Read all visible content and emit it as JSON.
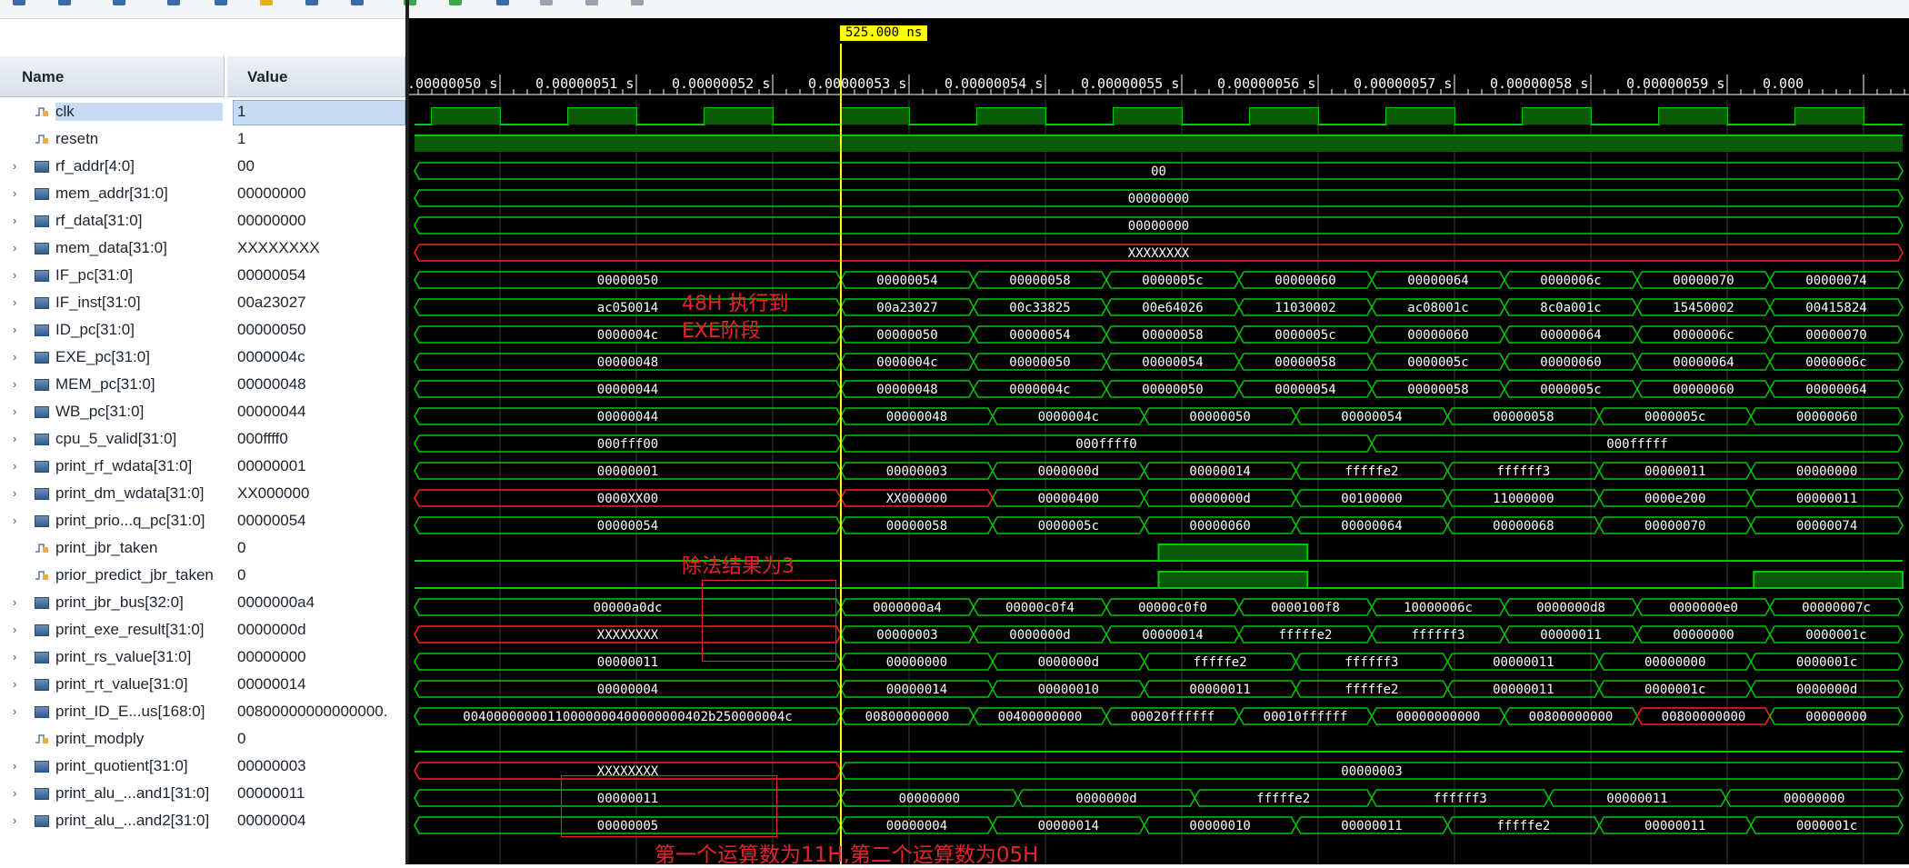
{
  "toolbar": {
    "buttons": [
      {
        "icon": "undo-icon",
        "color": "#3a6aa8"
      },
      {
        "icon": "save-icon",
        "color": "#3a6aa8"
      },
      {
        "icon": "zoom-in-icon",
        "color": "#3a6aa8"
      },
      {
        "icon": "zoom-out-icon",
        "color": "#3a6aa8"
      },
      {
        "icon": "zoom-fit-icon",
        "color": "#3a6aa8"
      },
      {
        "icon": "marker-icon",
        "color": "#e0b020"
      },
      {
        "icon": "go-to-start-icon",
        "color": "#3a6aa8"
      },
      {
        "icon": "go-to-end-icon",
        "color": "#3a6aa8"
      },
      {
        "icon": "previous-transition-icon",
        "color": "#3aa84a"
      },
      {
        "icon": "next-transition-icon",
        "color": "#3aa84a"
      },
      {
        "icon": "add-marker-icon",
        "color": "#3a6aa8"
      },
      {
        "icon": "previous-marker-icon",
        "color": "#9aa3ad"
      },
      {
        "icon": "next-marker-icon",
        "color": "#9aa3ad"
      },
      {
        "icon": "swap-cursors-icon",
        "color": "#9aa3ad"
      }
    ]
  },
  "columns": {
    "name": "Name",
    "value": "Value"
  },
  "cursor_time": "525.000 ns",
  "colors": {
    "bus": "#00c800",
    "bit": "#00c800",
    "invalid": "#ff2020",
    "cursor": "#ffff00",
    "annotation": "#e8232b",
    "waveform_background": "#000000"
  },
  "time_ticks": [
    "0.00000050 s",
    "0.00000051 s",
    "0.00000052 s",
    "0.00000053 s",
    "0.00000054 s",
    "0.00000055 s",
    "0.00000056 s",
    "0.00000057 s",
    "0.00000058 s",
    "0.00000059 s",
    "0.000"
  ],
  "signals": [
    {
      "name": "clk",
      "value": "1",
      "type": "clock"
    },
    {
      "name": "resetn",
      "value": "1",
      "type": "high"
    },
    {
      "name": "rf_addr[4:0]",
      "value": "00",
      "type": "bus",
      "segments": [
        {
          "text": "00"
        }
      ]
    },
    {
      "name": "mem_addr[31:0]",
      "value": "00000000",
      "type": "bus",
      "segments": [
        {
          "text": "00000000"
        }
      ]
    },
    {
      "name": "rf_data[31:0]",
      "value": "00000000",
      "type": "bus",
      "segments": [
        {
          "text": "00000000"
        }
      ]
    },
    {
      "name": "mem_data[31:0]",
      "value": "XXXXXXXX",
      "type": "bus",
      "segments": [
        {
          "text": "XXXXXXXX",
          "x": true
        }
      ]
    },
    {
      "name": "IF_pc[31:0]",
      "value": "00000054",
      "type": "bus",
      "segments": [
        {
          "text": "00000050"
        },
        {
          "text": "00000054"
        },
        {
          "text": "00000058"
        },
        {
          "text": "0000005c"
        },
        {
          "text": "00000060"
        },
        {
          "text": "00000064"
        },
        {
          "text": "0000006c"
        },
        {
          "text": "00000070"
        },
        {
          "text": "00000074"
        }
      ]
    },
    {
      "name": "IF_inst[31:0]",
      "value": "00a23027",
      "type": "bus",
      "segments": [
        {
          "text": "ac050014"
        },
        {
          "text": "00a23027"
        },
        {
          "text": "00c33825"
        },
        {
          "text": "00e64026"
        },
        {
          "text": "11030002"
        },
        {
          "text": "ac08001c"
        },
        {
          "text": "8c0a001c"
        },
        {
          "text": "15450002"
        },
        {
          "text": "00415824"
        }
      ]
    },
    {
      "name": "ID_pc[31:0]",
      "value": "00000050",
      "type": "bus",
      "segments": [
        {
          "text": "0000004c"
        },
        {
          "text": "00000050"
        },
        {
          "text": "00000054"
        },
        {
          "text": "00000058"
        },
        {
          "text": "0000005c"
        },
        {
          "text": "00000060"
        },
        {
          "text": "00000064"
        },
        {
          "text": "0000006c"
        },
        {
          "text": "00000070"
        }
      ]
    },
    {
      "name": "EXE_pc[31:0]",
      "value": "0000004c",
      "type": "bus",
      "segments": [
        {
          "text": "00000048"
        },
        {
          "text": "0000004c"
        },
        {
          "text": "00000050"
        },
        {
          "text": "00000054"
        },
        {
          "text": "00000058"
        },
        {
          "text": "0000005c"
        },
        {
          "text": "00000060"
        },
        {
          "text": "00000064"
        },
        {
          "text": "0000006c"
        }
      ]
    },
    {
      "name": "MEM_pc[31:0]",
      "value": "00000048",
      "type": "bus",
      "segments": [
        {
          "text": "00000044"
        },
        {
          "text": "00000048"
        },
        {
          "text": "0000004c"
        },
        {
          "text": "00000050"
        },
        {
          "text": "00000054"
        },
        {
          "text": "00000058"
        },
        {
          "text": "0000005c"
        },
        {
          "text": "00000060"
        },
        {
          "text": "00000064"
        }
      ]
    },
    {
      "name": "WB_pc[31:0]",
      "value": "00000044",
      "type": "bus",
      "segments": [
        {
          "text": "00000044"
        },
        {
          "text": "00000048"
        },
        {
          "text": "0000004c"
        },
        {
          "text": "00000050"
        },
        {
          "text": "00000054"
        },
        {
          "text": "00000058"
        },
        {
          "text": "0000005c"
        },
        {
          "text": "00000060"
        }
      ]
    },
    {
      "name": "cpu_5_valid[31:0]",
      "value": "000ffff0",
      "type": "bus",
      "segments": [
        {
          "text": "000fff00"
        },
        {
          "text": "000ffff0"
        },
        {
          "text": "000fffff"
        }
      ]
    },
    {
      "name": "print_rf_wdata[31:0]",
      "value": "00000001",
      "type": "bus",
      "segments": [
        {
          "text": "00000001"
        },
        {
          "text": "00000003"
        },
        {
          "text": "0000000d"
        },
        {
          "text": "00000014"
        },
        {
          "text": "fffffe2"
        },
        {
          "text": "ffffff3"
        },
        {
          "text": "00000011"
        },
        {
          "text": "00000000"
        }
      ]
    },
    {
      "name": "print_dm_wdata[31:0]",
      "value": "XX000000",
      "type": "bus",
      "segments": [
        {
          "text": "0000XX00",
          "x": true
        },
        {
          "text": "XX000000",
          "x": true
        },
        {
          "text": "00000400"
        },
        {
          "text": "0000000d"
        },
        {
          "text": "00100000"
        },
        {
          "text": "11000000"
        },
        {
          "text": "0000e200"
        },
        {
          "text": "00000011"
        }
      ]
    },
    {
      "name": "print_prio...q_pc[31:0]",
      "value": "00000054",
      "type": "bus",
      "segments": [
        {
          "text": "00000054"
        },
        {
          "text": "00000058"
        },
        {
          "text": "0000005c"
        },
        {
          "text": "00000060"
        },
        {
          "text": "00000064"
        },
        {
          "text": "00000068"
        },
        {
          "text": "00000070"
        },
        {
          "text": "00000074"
        }
      ]
    },
    {
      "name": "print_jbr_taken",
      "value": "0",
      "type": "bit",
      "highs": [
        [
          0.5,
          0.6
        ]
      ]
    },
    {
      "name": "prior_predict_jbr_taken",
      "value": "0",
      "type": "bit",
      "highs": [
        [
          0.5,
          0.6
        ],
        [
          0.9,
          1.0
        ]
      ]
    },
    {
      "name": "print_jbr_bus[32:0]",
      "value": "0000000a4",
      "type": "bus",
      "segments": [
        {
          "text": "00000a0dc"
        },
        {
          "text": "0000000a4"
        },
        {
          "text": "00000c0f4"
        },
        {
          "text": "00000c0f0"
        },
        {
          "text": "0000100f8"
        },
        {
          "text": "10000006c"
        },
        {
          "text": "0000000d8"
        },
        {
          "text": "0000000e0"
        },
        {
          "text": "00000007c"
        }
      ]
    },
    {
      "name": "print_exe_result[31:0]",
      "value": "0000000d",
      "type": "bus",
      "segments": [
        {
          "text": "XXXXXXXX",
          "x": true
        },
        {
          "text": "00000003"
        },
        {
          "text": "0000000d"
        },
        {
          "text": "00000014"
        },
        {
          "text": "fffffe2"
        },
        {
          "text": "ffffff3"
        },
        {
          "text": "00000011"
        },
        {
          "text": "00000000"
        },
        {
          "text": "0000001c"
        }
      ]
    },
    {
      "name": "print_rs_value[31:0]",
      "value": "00000000",
      "type": "bus",
      "segments": [
        {
          "text": "00000011"
        },
        {
          "text": "00000000"
        },
        {
          "text": "0000000d"
        },
        {
          "text": "fffffe2"
        },
        {
          "text": "ffffff3"
        },
        {
          "text": "00000011"
        },
        {
          "text": "00000000"
        },
        {
          "text": "0000001c"
        }
      ]
    },
    {
      "name": "print_rt_value[31:0]",
      "value": "00000014",
      "type": "bus",
      "segments": [
        {
          "text": "00000004"
        },
        {
          "text": "00000014"
        },
        {
          "text": "00000010"
        },
        {
          "text": "00000011"
        },
        {
          "text": "fffffe2"
        },
        {
          "text": "00000011"
        },
        {
          "text": "0000001c"
        },
        {
          "text": "0000000d"
        }
      ]
    },
    {
      "name": "print_ID_E...us[168:0]",
      "value": "00800000000000000.",
      "type": "bus",
      "segments": [
        {
          "text": "00400000000110000000400000000402b250000004c"
        },
        {
          "text": "00800000000"
        },
        {
          "text": "00400000000"
        },
        {
          "text": "00020ffffff"
        },
        {
          "text": "00010ffffff"
        },
        {
          "text": "00000000000"
        },
        {
          "text": "00800000000"
        },
        {
          "text": "00800000000",
          "x": true
        },
        {
          "text": "00000000"
        }
      ]
    },
    {
      "name": "print_modply",
      "value": "0",
      "type": "low"
    },
    {
      "name": "print_quotient[31:0]",
      "value": "00000003",
      "type": "bus",
      "segments": [
        {
          "text": "XXXXXXXX",
          "x": true
        },
        {
          "text": "00000003"
        }
      ]
    },
    {
      "name": "print_alu_...and1[31:0]",
      "value": "00000011",
      "type": "bus",
      "segments": [
        {
          "text": "00000011"
        },
        {
          "text": "00000000"
        },
        {
          "text": "0000000d"
        },
        {
          "text": "fffffe2"
        },
        {
          "text": "ffffff3"
        },
        {
          "text": "00000011"
        },
        {
          "text": "00000000"
        }
      ]
    },
    {
      "name": "print_alu_...and2[31:0]",
      "value": "00000004",
      "type": "bus",
      "segments": [
        {
          "text": "00000005"
        },
        {
          "text": "00000004"
        },
        {
          "text": "00000014"
        },
        {
          "text": "00000010"
        },
        {
          "text": "00000011"
        },
        {
          "text": "fffffe2"
        },
        {
          "text": "00000011"
        },
        {
          "text": "0000001c"
        }
      ]
    }
  ],
  "annotations": {
    "exe_stage": "48H 执行到\nEXE阶段",
    "div_result": "除法结果为3",
    "operands": "第一个运算数为11H,第二个运算数为05H"
  }
}
